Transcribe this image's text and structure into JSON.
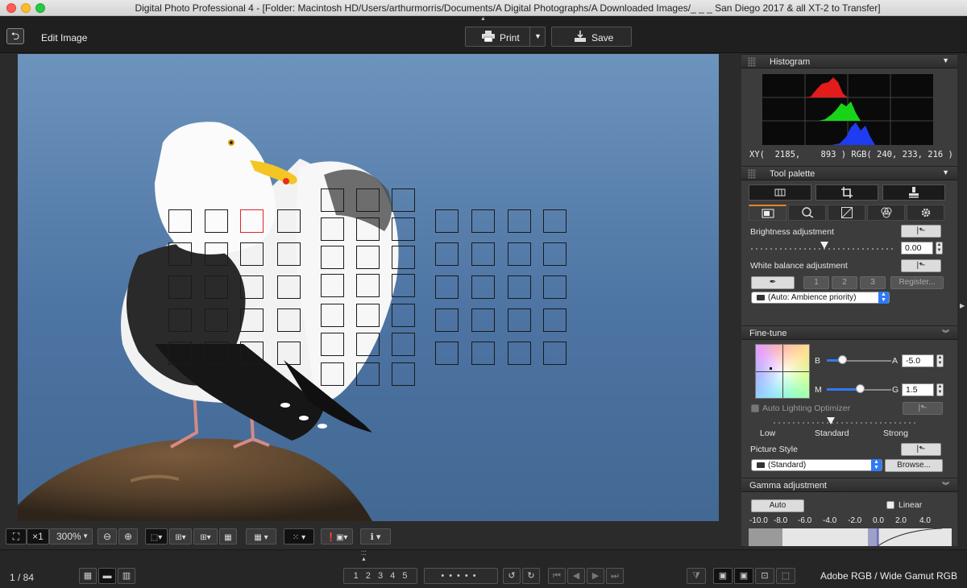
{
  "window": {
    "title": "Digital Photo Professional 4 - [Folder: Macintosh HD/Users/arthurmorris/Documents/A Digital Photographs/A Downloaded Images/_ _ _  San Diego 2017 & all XT-2 to Transfer]"
  },
  "toolbar": {
    "edit_title": "Edit Image",
    "print_label": "Print",
    "save_label": "Save"
  },
  "viewbar": {
    "zoom_x": "×1",
    "zoom_level": "300%"
  },
  "statusbar": {
    "page_count": "1 / 84",
    "ratings": [
      "1",
      "2",
      "3",
      "4",
      "5"
    ],
    "color_space": "Adobe RGB / Wide Gamut RGB"
  },
  "histogram": {
    "title": "Histogram",
    "readout": "XY(  2185,    893 ) RGB( 240, 233, 216 )",
    "colors": {
      "red": "#e31b1b",
      "green": "#18d418",
      "blue": "#1f3cf0"
    }
  },
  "tool_palette": {
    "title": "Tool palette",
    "brightness": {
      "label": "Brightness adjustment",
      "value": "0.00",
      "level": 0.5
    },
    "white_balance": {
      "label": "White balance adjustment",
      "presets": [
        "1",
        "2",
        "3"
      ],
      "register_label": "Register...",
      "selected": "(Auto: Ambience priority)"
    }
  },
  "fine_tune": {
    "title": "Fine-tune",
    "b_label": "B",
    "a_label": "A",
    "a_value": "-5.0",
    "m_label": "M",
    "g_label": "G",
    "g_value": "1.5",
    "alo_label": "Auto Lighting Optimizer",
    "alo_levels": [
      "Low",
      "Standard",
      "Strong"
    ],
    "picture_style_label": "Picture Style",
    "picture_style_value": "(Standard)",
    "browse_label": "Browse..."
  },
  "gamma": {
    "title": "Gamma adjustment",
    "auto_label": "Auto",
    "linear_label": "Linear",
    "scale": [
      "-10.0",
      "-8.0",
      "-6.0",
      "-4.0",
      "-2.0",
      "0.0",
      "2.0",
      "4.0"
    ]
  },
  "accent": "#2f7bf6",
  "tab_accent": "#e08a1e"
}
